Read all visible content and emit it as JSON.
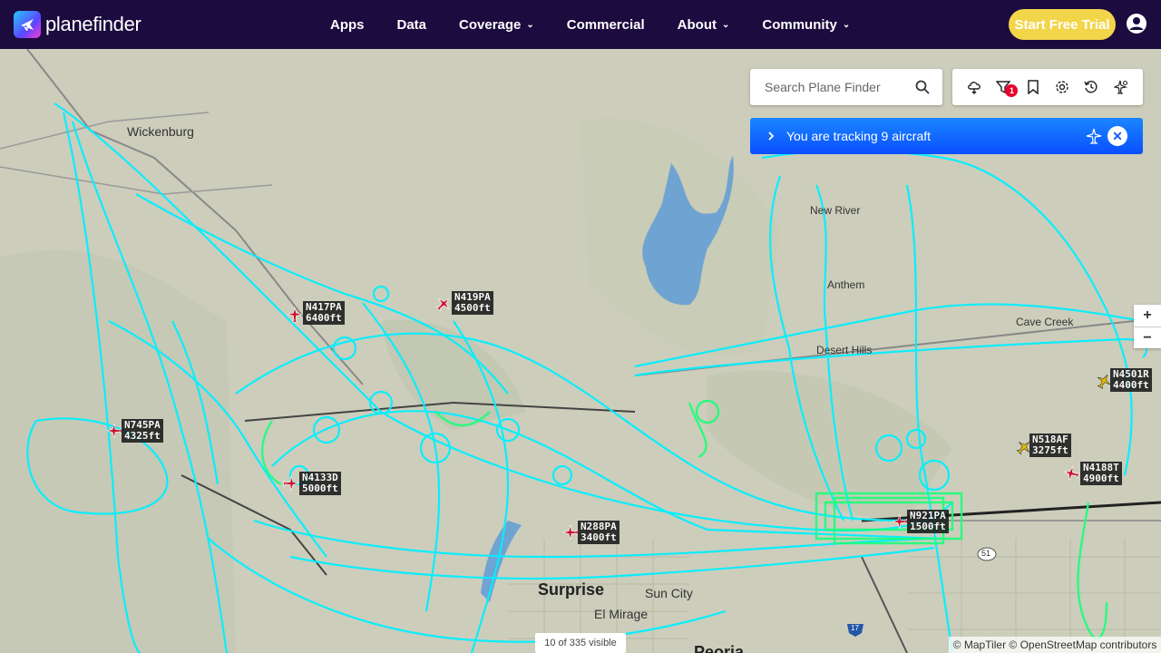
{
  "brand": {
    "name": "planefinder"
  },
  "nav": {
    "items": [
      {
        "label": "Apps",
        "has_menu": false
      },
      {
        "label": "Data",
        "has_menu": false
      },
      {
        "label": "Coverage",
        "has_menu": true
      },
      {
        "label": "Commercial",
        "has_menu": false
      },
      {
        "label": "About",
        "has_menu": true
      },
      {
        "label": "Community",
        "has_menu": true
      }
    ],
    "trial_label": "Start Free Trial"
  },
  "search": {
    "placeholder": "Search Plane Finder"
  },
  "toolbar": {
    "tools": [
      "weather-icon",
      "filter-icon",
      "bookmark-icon",
      "settings-icon",
      "history-icon",
      "aircraft-settings-icon"
    ],
    "filter_badge": "1"
  },
  "tracking": {
    "text": "You are tracking 9 aircraft"
  },
  "zoom": {
    "in": "+",
    "out": "−"
  },
  "aircraft": [
    {
      "callsign": "N417PA",
      "altitude": "6400ft",
      "color": "#c8102e"
    },
    {
      "callsign": "N419PA",
      "altitude": "4500ft",
      "color": "#c8102e"
    },
    {
      "callsign": "N745PA",
      "altitude": "4325ft",
      "color": "#c8102e"
    },
    {
      "callsign": "N4133D",
      "altitude": "5000ft",
      "color": "#c8102e"
    },
    {
      "callsign": "N288PA",
      "altitude": "3400ft",
      "color": "#c8102e"
    },
    {
      "callsign": "N921PA",
      "altitude": "1500ft",
      "color": "#c8102e"
    },
    {
      "callsign": "N518AF",
      "altitude": "3275ft",
      "color": "#e8c000"
    },
    {
      "callsign": "N4188T",
      "altitude": "4900ft",
      "color": "#c8102e"
    },
    {
      "callsign": "N4501R",
      "altitude": "4400ft",
      "color": "#e8c000"
    }
  ],
  "places": [
    "Wickenburg",
    "New River",
    "Anthem",
    "Cave Creek",
    "Desert Hills",
    "Surprise",
    "Sun City",
    "El Mirage",
    "Peoria"
  ],
  "road_shields": [
    "51",
    "17"
  ],
  "status": {
    "visible": "10 of 335 visible"
  },
  "attribution": "© MapTiler © OpenStreetMap contributors",
  "colors": {
    "header": "#1b0b3f",
    "trial": "#f3d54a",
    "track": "#00f0ff",
    "track_low": "#1aff7a",
    "tracking_bar": "#0a4fff"
  }
}
